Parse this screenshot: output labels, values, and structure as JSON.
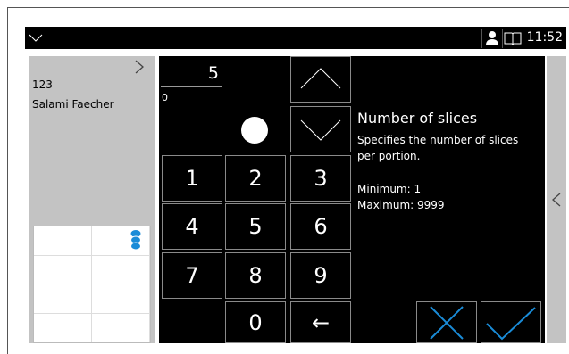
{
  "topbar": {
    "time": "11:52",
    "icons": [
      "chevron-down-icon",
      "user-icon",
      "book-icon"
    ]
  },
  "left_panel": {
    "product_number": "123",
    "product_name": "Salami Faecher"
  },
  "input": {
    "value": "5",
    "sub_value": "0"
  },
  "keypad": {
    "keys": [
      "1",
      "2",
      "3",
      "4",
      "5",
      "6",
      "7",
      "8",
      "9",
      "0",
      "←"
    ]
  },
  "info": {
    "title": "Number of slices",
    "description": "Specifies the number of slices per portion.",
    "minimum": "Minimum: 1",
    "maximum": "Maximum: 9999"
  },
  "colors": {
    "panel_bg": "#000000",
    "side_bg": "#c3c3c3",
    "accent": "#1a8cd8"
  }
}
